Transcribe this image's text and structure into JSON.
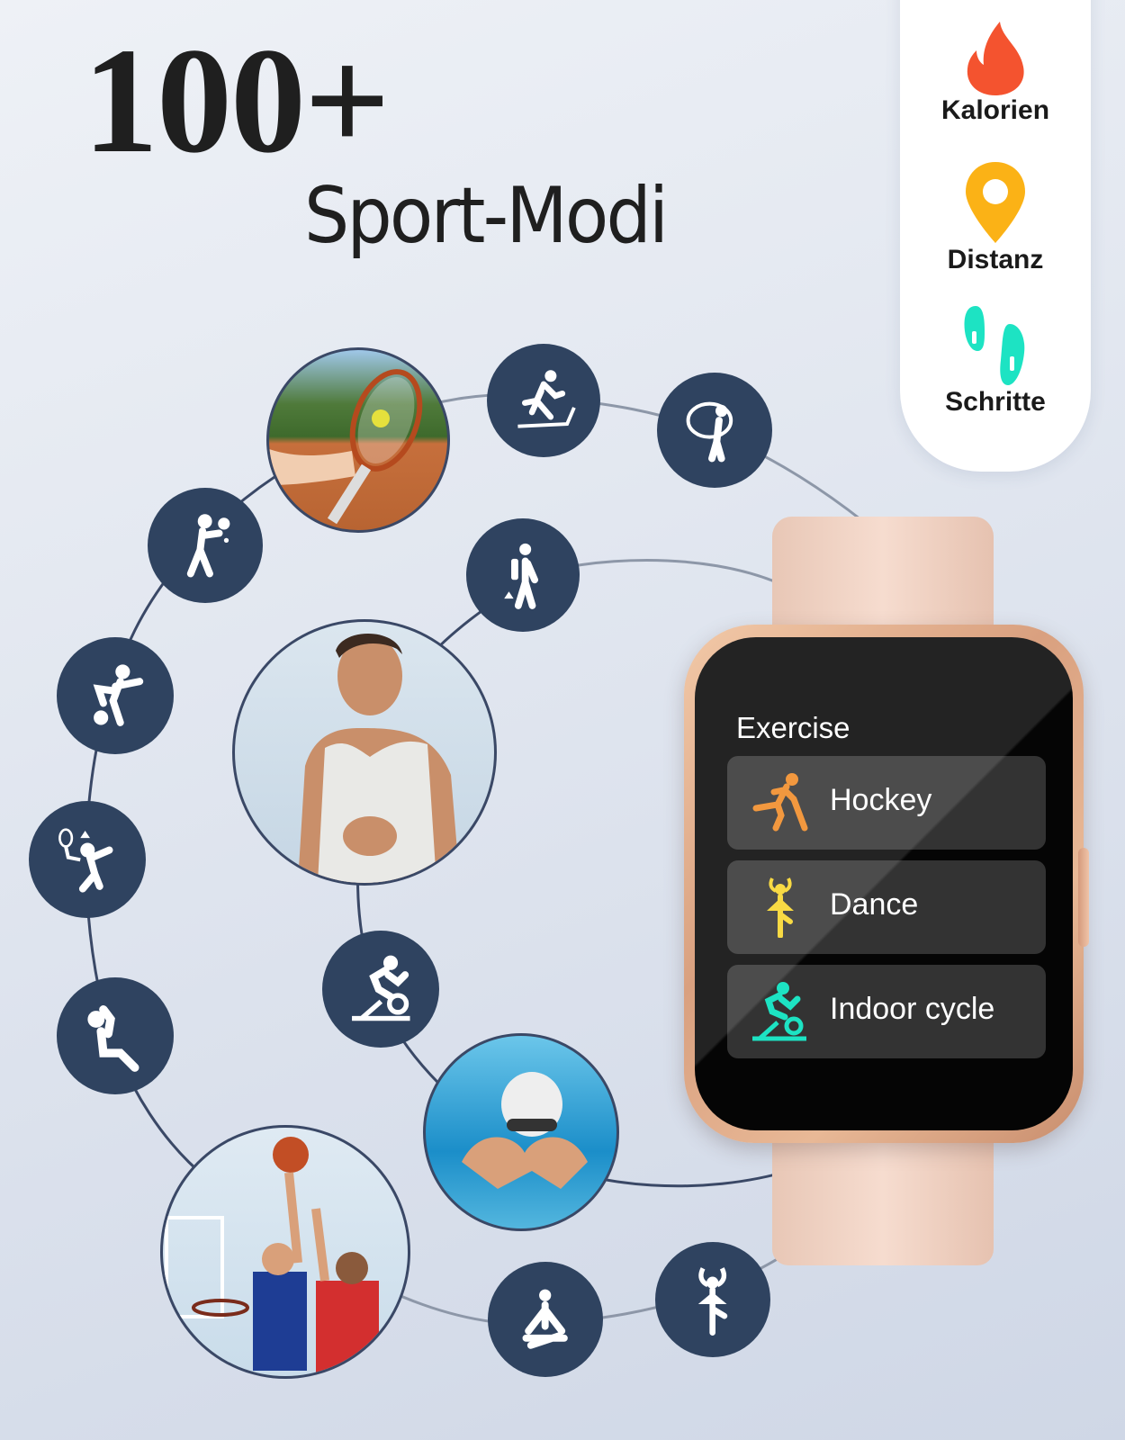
{
  "headline": {
    "number": "100+",
    "subtitle": "Sport-Modi"
  },
  "features": [
    {
      "label": "Kalorien",
      "icon": "flame-icon",
      "color": "#f4532f"
    },
    {
      "label": "Distanz",
      "icon": "map-pin-icon",
      "color": "#fbb216"
    },
    {
      "label": "Schritte",
      "icon": "footprints-icon",
      "color": "#1de3c3"
    }
  ],
  "sport_bubbles": [
    {
      "icon": "tennis-photo",
      "kind": "photo"
    },
    {
      "icon": "treadmill-icon",
      "kind": "icon"
    },
    {
      "icon": "jump-rope-icon",
      "kind": "icon"
    },
    {
      "icon": "table-tennis-icon",
      "kind": "icon"
    },
    {
      "icon": "hiking-icon",
      "kind": "icon"
    },
    {
      "icon": "soccer-icon",
      "kind": "icon"
    },
    {
      "icon": "running-man-photo",
      "kind": "photo"
    },
    {
      "icon": "badminton-icon",
      "kind": "icon"
    },
    {
      "icon": "sit-up-icon",
      "kind": "icon"
    },
    {
      "icon": "spinning-bike-icon",
      "kind": "icon"
    },
    {
      "icon": "swimming-photo",
      "kind": "photo"
    },
    {
      "icon": "basketball-photo",
      "kind": "photo"
    },
    {
      "icon": "yoga-icon",
      "kind": "icon"
    },
    {
      "icon": "ballet-icon",
      "kind": "icon"
    }
  ],
  "watch": {
    "screen_title": "Exercise",
    "items": [
      {
        "label": "Hockey",
        "icon": "hockey-icon",
        "color": "#f08a24"
      },
      {
        "label": "Dance",
        "icon": "dance-icon",
        "color": "#f7d52a"
      },
      {
        "label": "Indoor cycle",
        "icon": "indoor-cycle-icon",
        "color": "#1de3c3"
      }
    ]
  },
  "colors": {
    "bubble": "#2f4360",
    "link_line": "#8d97a8",
    "watch_case": "#e0aa88"
  }
}
